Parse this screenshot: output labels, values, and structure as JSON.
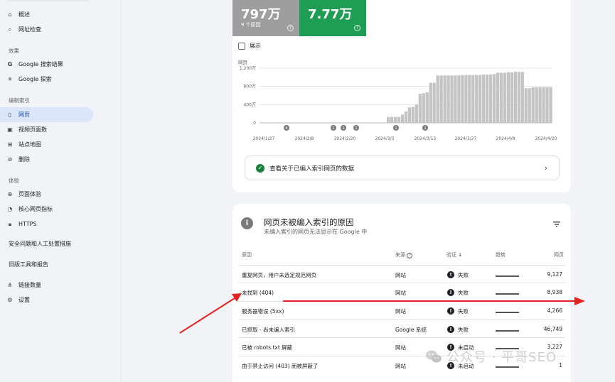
{
  "sidebar": {
    "items_top": [
      {
        "label": "概述",
        "icon": "home-icon"
      },
      {
        "label": "网址检查",
        "icon": "search-icon"
      }
    ],
    "section_effect": "效果",
    "effect_items": [
      {
        "label": "Google 搜索结果",
        "icon": "google-icon"
      },
      {
        "label": "Google 探索",
        "icon": "asterisk-icon"
      }
    ],
    "section_index": "编制索引",
    "index_items": [
      {
        "label": "网页",
        "icon": "page-icon",
        "active": true
      },
      {
        "label": "视频页面数",
        "icon": "video-page-icon"
      },
      {
        "label": "站点地图",
        "icon": "sitemap-icon"
      },
      {
        "label": "删除",
        "icon": "remove-icon"
      }
    ],
    "section_exp": "体验",
    "exp_items": [
      {
        "label": "页面体验",
        "icon": "plus-circle-icon"
      },
      {
        "label": "核心网页指标",
        "icon": "speed-icon"
      },
      {
        "label": "HTTPS",
        "icon": "lock-icon"
      }
    ],
    "section_security": "安全问题和人工处置措施",
    "section_legacy": "旧版工具和报告",
    "bottom_items": [
      {
        "label": "链接数量",
        "icon": "links-icon"
      },
      {
        "label": "设置",
        "icon": "gear-icon"
      }
    ]
  },
  "summary": {
    "not_indexed_value": "797万",
    "not_indexed_sub": "9 个原因",
    "not_indexed_color": "#9e9e9e",
    "indexed_value": "7.77万",
    "indexed_color": "#1e9e54"
  },
  "show_label": "展示",
  "chart_data": {
    "type": "bar",
    "ylabel": "网页",
    "yticks": [
      "1,200万",
      "800万",
      "400万",
      "0"
    ],
    "ylim": [
      0,
      12000000
    ],
    "xticks": [
      "2024/1/27",
      "2024/2/8",
      "2024/2/20",
      "2024/3/3",
      "2024/3/15",
      "2024/3/27",
      "2024/4/8",
      "2024/4/20"
    ],
    "markers": [
      "4",
      "1",
      "1",
      "1",
      "1",
      "1"
    ],
    "bar_color": "#c4c4c4",
    "values": [
      0,
      0,
      0,
      0,
      0,
      0,
      0,
      0,
      0,
      0,
      0,
      0,
      0,
      0,
      0,
      0,
      0,
      0,
      0,
      0,
      0,
      0,
      0,
      0,
      0,
      0,
      0,
      0,
      0,
      0,
      0,
      0,
      0,
      0,
      0,
      0,
      1300000,
      1300000,
      1300000,
      1300000,
      1800000,
      2500000,
      3400000,
      3500000,
      4000000,
      6400000,
      6500000,
      6700000,
      8800000,
      8800000,
      10400000,
      10400000,
      10400000,
      10400000,
      10400000,
      10400000,
      10400000,
      10500000,
      10500000,
      10500000,
      10500000,
      10500000,
      10500000,
      10600000,
      10600000,
      10600000,
      10700000,
      11000000,
      11000000,
      11000000,
      11100000,
      11100000,
      11200000,
      11200000,
      11200000,
      7600000,
      7600000,
      7800000,
      7800000,
      7800000,
      7800000,
      7800000,
      7800000
    ]
  },
  "info_row_label": "查看关于已编入索引网页的数据",
  "why": {
    "title": "网页未被编入索引的原因",
    "subtitle": "未编入索引的网页无法显示在 Google 中",
    "headers": {
      "reason": "原因",
      "source": "来源",
      "validation": "验证",
      "trend": "趋势",
      "pages": "网页"
    },
    "rows": [
      {
        "reason": "重复网页，用户未选定规范网页",
        "source": "网站",
        "status": "失败",
        "pages": "9,127"
      },
      {
        "reason": "未找到 (404)",
        "source": "网站",
        "status": "失败",
        "pages": "8,938"
      },
      {
        "reason": "服务器错误 (5xx)",
        "source": "网站",
        "status": "失败",
        "pages": "4,266"
      },
      {
        "reason": "已抓取 - 尚未编入索引",
        "source": "Google 系统",
        "status": "失败",
        "pages": "46,749"
      },
      {
        "reason": "已被 robots.txt 屏蔽",
        "source": "网站",
        "status": "未启动",
        "pages": "3,227"
      },
      {
        "reason": "由于禁止访问 (403) 而被屏蔽了",
        "source": "网站",
        "status": "未启动",
        "pages": "1"
      }
    ]
  },
  "watermark": "公众号 · 平哥SEO"
}
